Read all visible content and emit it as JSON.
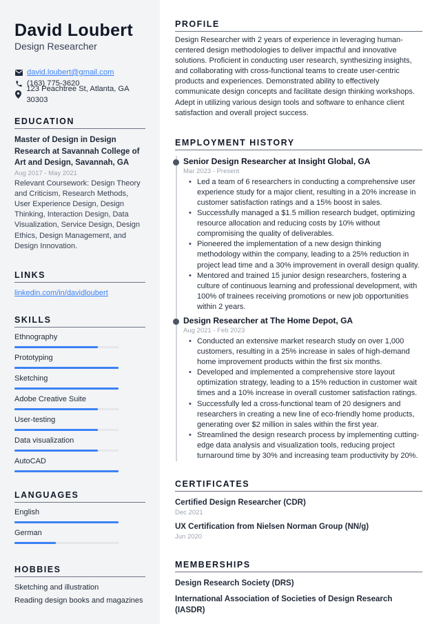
{
  "header": {
    "name": "David Loubert",
    "title": "Design Researcher"
  },
  "contact": {
    "email": "david.loubert@gmail.com",
    "phone": "(163) 775-3620",
    "address": "123 Peachtree St, Atlanta, GA 30303",
    "icons": {
      "email": "envelope-icon",
      "phone": "phone-icon",
      "address": "map-pin-icon"
    }
  },
  "education": {
    "heading": "EDUCATION",
    "items": [
      {
        "degree": "Master of Design in Design Research at Savannah College of Art and Design, Savannah, GA",
        "dates": "Aug 2017 - May 2021",
        "description": "Relevant Coursework: Design Theory and Criticism, Research Methods, User Experience Design, Design Thinking, Interaction Design, Data Visualization, Service Design, Design Ethics, Design Management, and Design Innovation."
      }
    ]
  },
  "links": {
    "heading": "LINKS",
    "items": [
      {
        "label": "linkedin.com/in/davidloubert"
      }
    ]
  },
  "skills": {
    "heading": "SKILLS",
    "items": [
      {
        "label": "Ethnography",
        "level": 0.8
      },
      {
        "label": "Prototyping",
        "level": 1.0
      },
      {
        "label": "Sketching",
        "level": 1.0
      },
      {
        "label": "Adobe Creative Suite",
        "level": 0.8
      },
      {
        "label": "User-testing",
        "level": 0.8
      },
      {
        "label": "Data visualization",
        "level": 0.8
      },
      {
        "label": "AutoCAD",
        "level": 1.0
      }
    ]
  },
  "languages": {
    "heading": "LANGUAGES",
    "items": [
      {
        "label": "English",
        "level": 1.0
      },
      {
        "label": "German",
        "level": 0.4
      }
    ]
  },
  "hobbies": {
    "heading": "HOBBIES",
    "items": [
      "Sketching and illustration",
      "Reading design books and magazines"
    ]
  },
  "profile": {
    "heading": "PROFILE",
    "text": "Design Researcher with 2 years of experience in leveraging human-centered design methodologies to deliver impactful and innovative solutions. Proficient in conducting user research, synthesizing insights, and collaborating with cross-functional teams to create user-centric products and experiences. Demonstrated ability to effectively communicate design concepts and facilitate design thinking workshops. Adept in utilizing various design tools and software to enhance client satisfaction and overall project success."
  },
  "employment": {
    "heading": "EMPLOYMENT HISTORY",
    "jobs": [
      {
        "title": "Senior Design Researcher at Insight Global, GA",
        "dates": "Mar 2023 - Present",
        "bullets": [
          "Led a team of 6 researchers in conducting a comprehensive user experience study for a major client, resulting in a 20% increase in customer satisfaction ratings and a 15% boost in sales.",
          "Successfully managed a $1.5 million research budget, optimizing resource allocation and reducing costs by 10% without compromising the quality of deliverables.",
          "Pioneered the implementation of a new design thinking methodology within the company, leading to a 25% reduction in project lead time and a 30% improvement in overall design quality.",
          "Mentored and trained 15 junior design researchers, fostering a culture of continuous learning and professional development, with 100% of trainees receiving promotions or new job opportunities within 2 years."
        ]
      },
      {
        "title": "Design Researcher at The Home Depot, GA",
        "dates": "Aug 2021 - Feb 2023",
        "bullets": [
          "Conducted an extensive market research study on over 1,000 customers, resulting in a 25% increase in sales of high-demand home improvement products within the first six months.",
          "Developed and implemented a comprehensive store layout optimization strategy, leading to a 15% reduction in customer wait times and a 10% increase in overall customer satisfaction ratings.",
          "Successfully led a cross-functional team of 20 designers and researchers in creating a new line of eco-friendly home products, generating over $2 million in sales within the first year.",
          "Streamlined the design research process by implementing cutting-edge data analysis and visualization tools, reducing project turnaround time by 30% and increasing team productivity by 20%."
        ]
      }
    ]
  },
  "certificates": {
    "heading": "CERTIFICATES",
    "items": [
      {
        "title": "Certified Design Researcher (CDR)",
        "date": "Dec 2021"
      },
      {
        "title": "UX Certification from Nielsen Norman Group (NN/g)",
        "date": "Jun 2020"
      }
    ]
  },
  "memberships": {
    "heading": "MEMBERSHIPS",
    "items": [
      "Design Research Society (DRS)",
      "International Association of Societies of Design Research (IASDR)"
    ]
  },
  "colors": {
    "accent": "#3b82f6",
    "sidebar_bg": "#f3f4f6",
    "text": "#1f2937",
    "muted": "#9ca3af"
  }
}
